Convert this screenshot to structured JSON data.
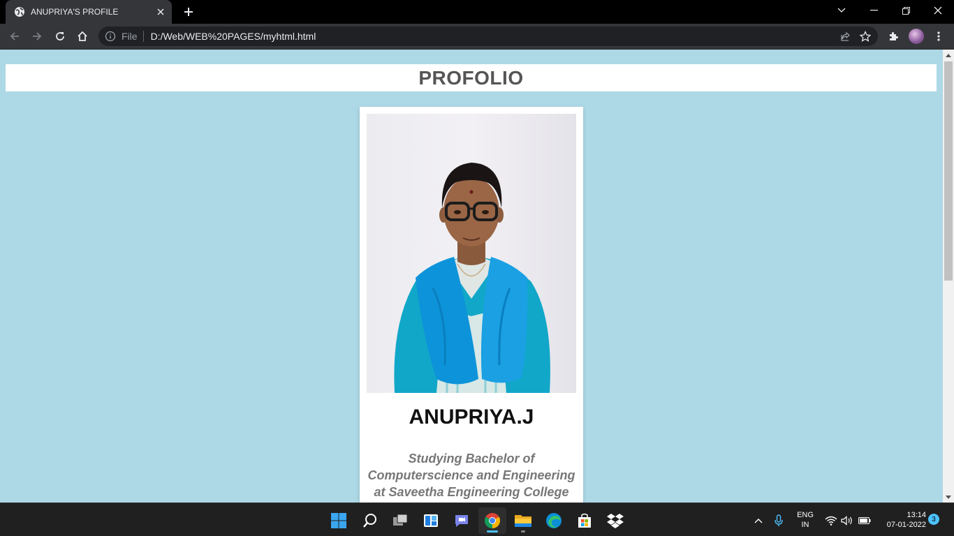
{
  "browser": {
    "tab_title": "ANUPRIYA'S PROFILE",
    "omnibox_scheme_label": "File",
    "url": "D:/Web/WEB%20PAGES/myhtml.html"
  },
  "page": {
    "banner_title": "PROFOLIO",
    "profile_name": "ANUPRIYA.J",
    "profile_desc_line1": "Studying Bachelor of",
    "profile_desc_line2": "Computerscience and Engineering",
    "profile_desc_line3": "at Saveetha Engineering College"
  },
  "taskbar": {
    "lang_line1": "ENG",
    "lang_line2": "IN",
    "time": "13:14",
    "date": "07-01-2022",
    "notification_count": "3"
  },
  "colors": {
    "page_background": "#add8e6",
    "accent": "#4cc2ff"
  }
}
